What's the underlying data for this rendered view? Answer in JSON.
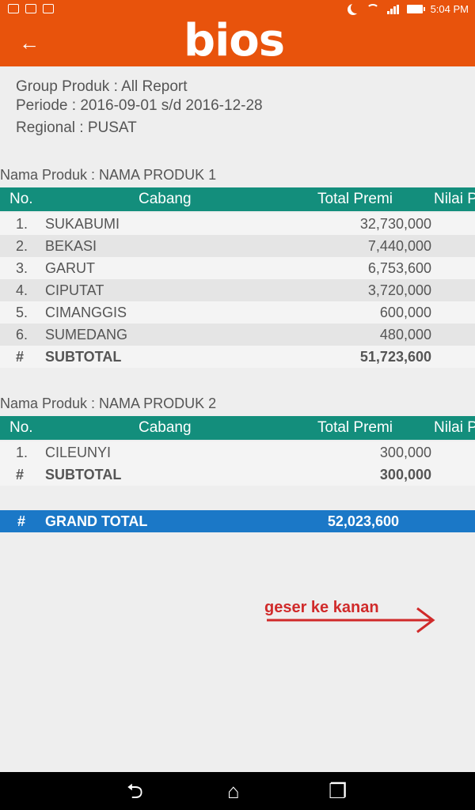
{
  "status_bar": {
    "time": "5:04 PM"
  },
  "app_bar": {
    "logo": "bios",
    "back_label": "←"
  },
  "report": {
    "group_produk": "Group Produk : All Report",
    "periode": "Periode : 2016-09-01 s/d 2016-12-28",
    "regional": "Regional : PUSAT"
  },
  "table_headers": {
    "no": "No.",
    "cabang": "Cabang",
    "total_premi": "Total Premi",
    "nilai": "Nilai P"
  },
  "sections": [
    {
      "title": "Nama Produk : NAMA PRODUK 1",
      "rows": [
        {
          "no": "1.",
          "cabang": "SUKABUMI",
          "total": "32,730,000"
        },
        {
          "no": "2.",
          "cabang": "BEKASI",
          "total": "7,440,000"
        },
        {
          "no": "3.",
          "cabang": "GARUT",
          "total": "6,753,600"
        },
        {
          "no": "4.",
          "cabang": "CIPUTAT",
          "total": "3,720,000"
        },
        {
          "no": "5.",
          "cabang": "CIMANGGIS",
          "total": "600,000"
        },
        {
          "no": "6.",
          "cabang": "SUMEDANG",
          "total": "480,000"
        }
      ],
      "subtotal": {
        "no": "#",
        "label": "SUBTOTAL",
        "total": "51,723,600"
      }
    },
    {
      "title": "Nama Produk : NAMA PRODUK 2",
      "rows": [
        {
          "no": "1.",
          "cabang": "CILEUNYI",
          "total": "300,000"
        }
      ],
      "subtotal": {
        "no": "#",
        "label": "SUBTOTAL",
        "total": "300,000"
      }
    }
  ],
  "grand_total": {
    "no": "#",
    "label": "GRAND TOTAL",
    "total": "52,023,600"
  },
  "hint": "geser ke kanan",
  "nav": {
    "back": "⮌",
    "home": "⌂",
    "recent": "❐"
  },
  "colors": {
    "brand": "#e8530c",
    "table_header": "#138e7c",
    "grand_total": "#1b78c7",
    "hint": "#d02a2a"
  }
}
